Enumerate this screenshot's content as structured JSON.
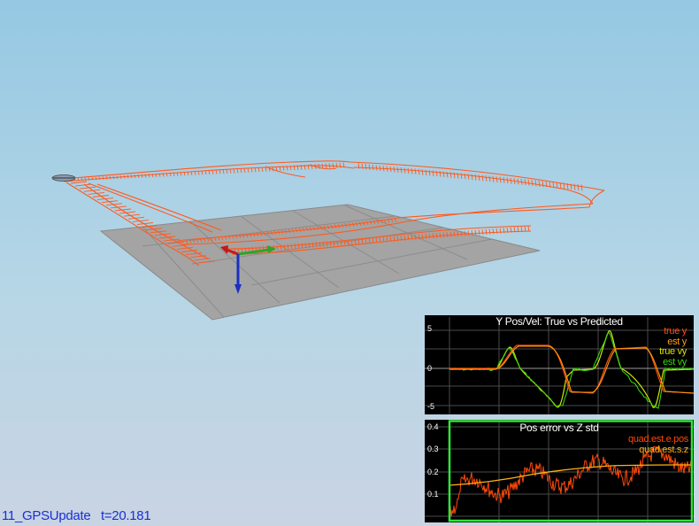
{
  "scene": {
    "type": "3d-quad-trajectory-view",
    "trajectory_color": "#ff5a1f",
    "ground_color": "#a4a4a4",
    "axis_colors": {
      "x": "#2aa62a",
      "y": "#c21a1a",
      "z": "#1a2fc2"
    }
  },
  "plots": [
    {
      "title": "Y Pos/Vel: True vs Predicted",
      "ylim": [
        -6,
        6
      ],
      "tick_labels": [
        {
          "label": "5",
          "value": 5
        },
        {
          "label": "0",
          "value": 0
        },
        {
          "label": "-5",
          "value": -5
        }
      ],
      "grid": true,
      "legend": [
        {
          "name": "true y",
          "color": "#ff4a0a"
        },
        {
          "name": "est y",
          "color": "#ff9f10"
        },
        {
          "name": "true vy",
          "color": "#d6e60a"
        },
        {
          "name": "est vy",
          "color": "#36d60a"
        }
      ]
    },
    {
      "title": "Pos error vs Z std",
      "ylim": [
        0,
        0.42
      ],
      "tick_labels": [
        {
          "label": "0.4",
          "value": 0.4
        },
        {
          "label": "0.3",
          "value": 0.3
        },
        {
          "label": "0.2",
          "value": 0.2
        },
        {
          "label": "0.1",
          "value": 0.1
        }
      ],
      "grid": true,
      "highlighted": true,
      "highlight_color": "#2ee63a",
      "legend": [
        {
          "name": "quad.est.e.pos",
          "color": "#ff4a0a"
        },
        {
          "name": "quad.est.s.z",
          "color": "#ffb010"
        }
      ]
    }
  ],
  "status": {
    "scenario": "11_GPSUpdate",
    "time": "t=20.181"
  }
}
